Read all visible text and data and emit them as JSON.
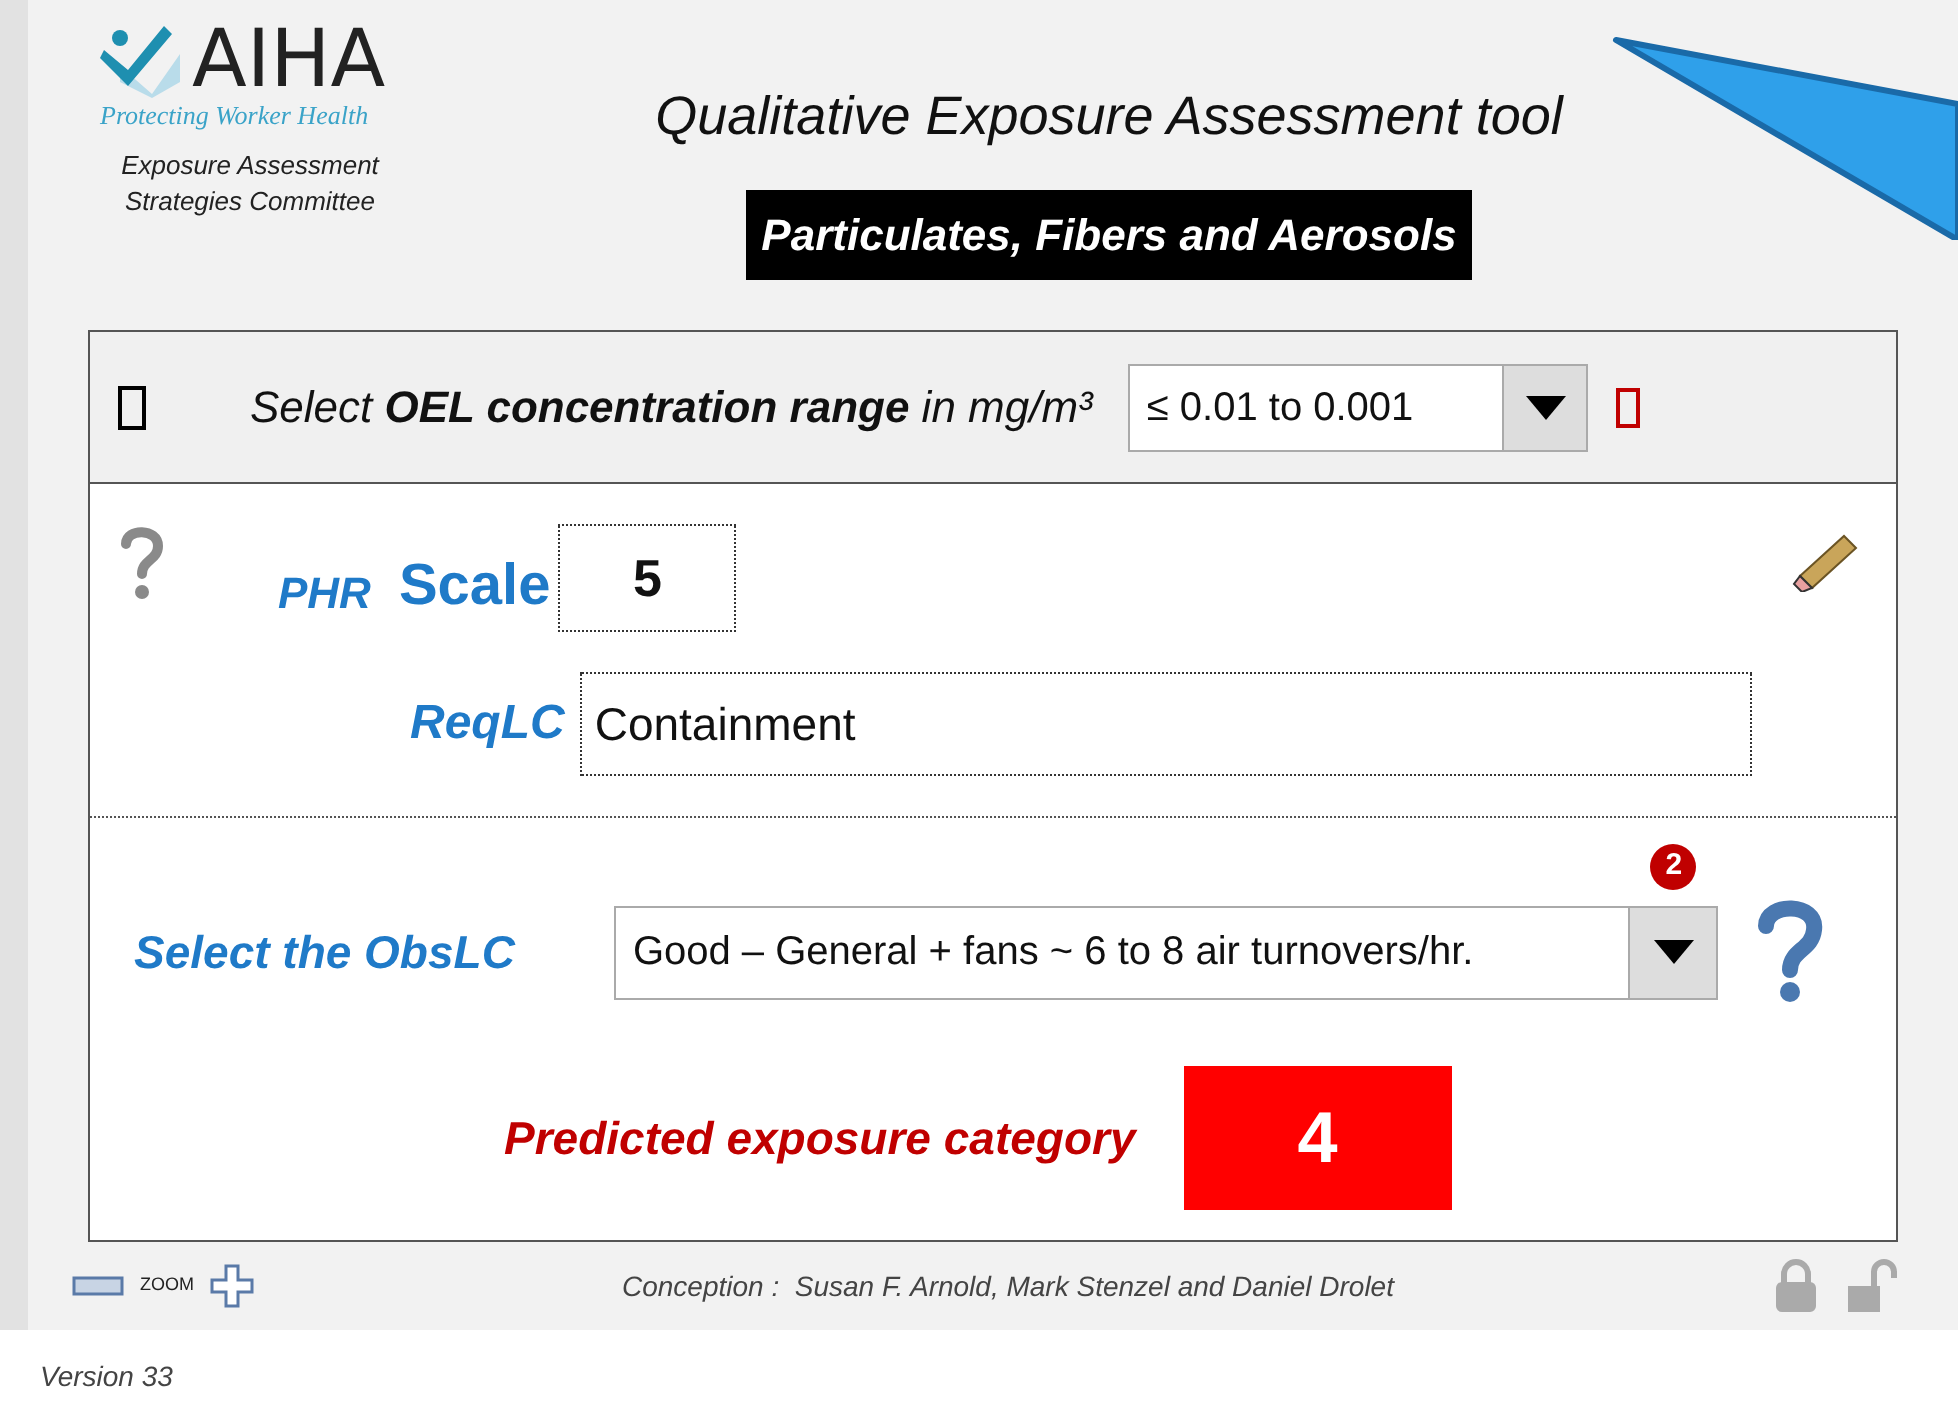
{
  "header": {
    "logo_text": "AIHA",
    "tagline": "Protecting Worker Health",
    "committee": [
      "Exposure Assessment",
      "Strategies Committee"
    ],
    "title": "Qualitative Exposure Assessment tool",
    "subtitle": "Particulates, Fibers and Aerosols"
  },
  "oel": {
    "label": "Select **OEL concentration range** in mg/m³",
    "value": "≤ 0.01 to 0.001"
  },
  "phr": {
    "label": "PHR",
    "scale_label": "Scale",
    "value": "5"
  },
  "reqlc": {
    "label": "ReqLC",
    "value": "Containment"
  },
  "obslc": {
    "label": "Select the ObsLC",
    "value": "Good – General + fans ~ 6 to 8 air turnovers/hr.",
    "badge": "2"
  },
  "prediction": {
    "label": "Predicted exposure category",
    "value": "4"
  },
  "footer": {
    "zoom_label": "ZOOM",
    "credits": "Conception :  Susan F. Arnold, Mark Stenzel and Daniel Drolet"
  },
  "version": "Version 33"
}
